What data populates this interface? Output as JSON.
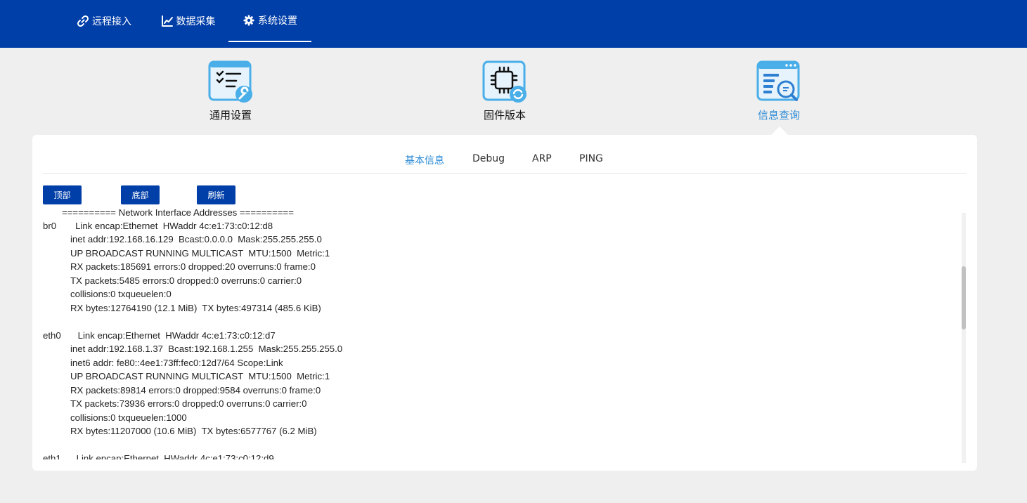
{
  "nav": {
    "items": [
      {
        "label": "远程接入",
        "icon": "link-icon"
      },
      {
        "label": "数据采集",
        "icon": "line-chart-icon"
      },
      {
        "label": "系统设置",
        "icon": "gear-icon"
      }
    ],
    "active_index": 2
  },
  "functions": [
    {
      "label": "通用设置",
      "icon": "settings-checklist-wrench-icon"
    },
    {
      "label": "固件版本",
      "icon": "chip-refresh-icon"
    },
    {
      "label": "信息查询",
      "icon": "document-search-icon"
    }
  ],
  "active_function_index": 2,
  "tabs": [
    "基本信息",
    "Debug",
    "ARP",
    "PING"
  ],
  "active_tab_index": 0,
  "buttons": {
    "top": "顶部",
    "bottom": "底部",
    "refresh": "刷新"
  },
  "log": {
    "header": "========== Network Interface Addresses ==========",
    "br0": {
      "name": "br0",
      "first": "Link encap:Ethernet  HWaddr 4c:e1:73:c0:12:d8",
      "lines": [
        "inet addr:192.168.16.129  Bcast:0.0.0.0  Mask:255.255.255.0",
        "UP BROADCAST RUNNING MULTICAST  MTU:1500  Metric:1",
        "RX packets:185691 errors:0 dropped:20 overruns:0 frame:0",
        "TX packets:5485 errors:0 dropped:0 overruns:0 carrier:0",
        "collisions:0 txqueuelen:0",
        "RX bytes:12764190 (12.1 MiB)  TX bytes:497314 (485.6 KiB)"
      ]
    },
    "eth0": {
      "name": "eth0",
      "first": "Link encap:Ethernet  HWaddr 4c:e1:73:c0:12:d7",
      "lines": [
        "inet addr:192.168.1.37  Bcast:192.168.1.255  Mask:255.255.255.0",
        "inet6 addr: fe80::4ee1:73ff:fec0:12d7/64 Scope:Link",
        "UP BROADCAST RUNNING MULTICAST  MTU:1500  Metric:1",
        "RX packets:89814 errors:0 dropped:9584 overruns:0 frame:0",
        "TX packets:73936 errors:0 dropped:0 overruns:0 carrier:0",
        "collisions:0 txqueuelen:1000",
        "RX bytes:11207000 (10.6 MiB)  TX bytes:6577767 (6.2 MiB)"
      ]
    },
    "eth1_partial": "eth1      Link encap:Ethernet  HWaddr 4c:e1:73:c0:12:d9"
  },
  "colors": {
    "topbar": "#003ea8",
    "accent": "#2d8bd6",
    "background": "#efefef"
  }
}
